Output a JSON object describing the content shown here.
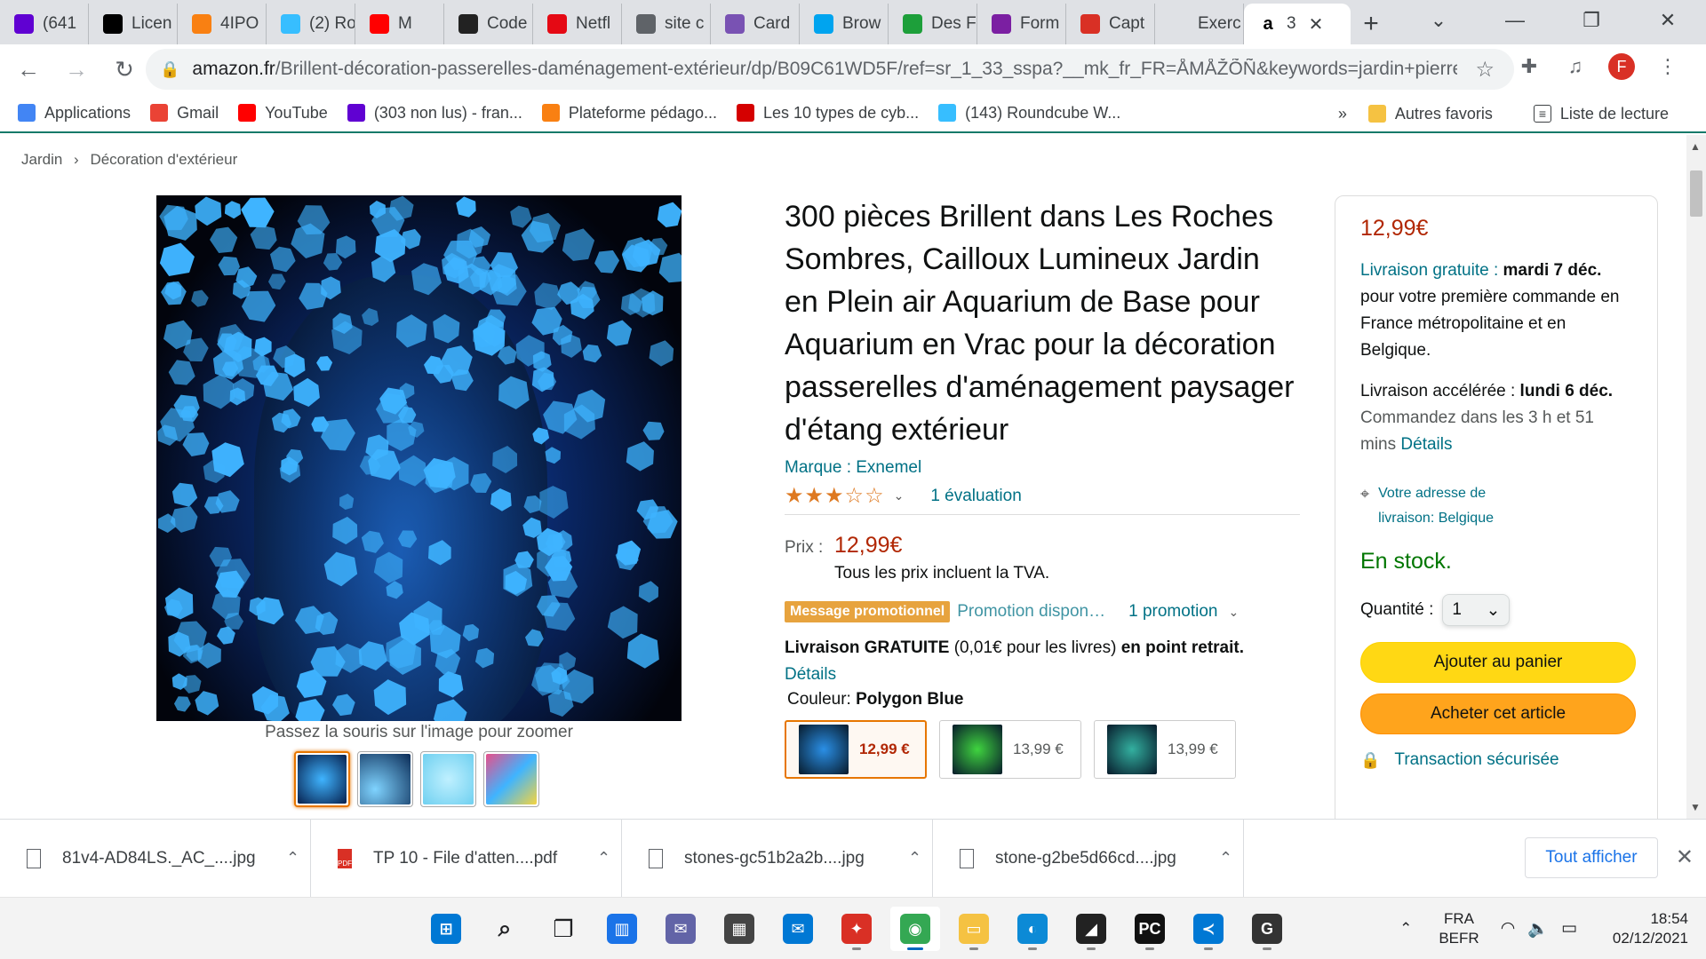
{
  "browser": {
    "tabs": [
      {
        "label": "(641",
        "icon": "mail-icon",
        "color": "#6001d2"
      },
      {
        "label": "Licen",
        "icon": "jetbrains-icon",
        "color": "#000000"
      },
      {
        "label": "4IPO",
        "icon": "moodle-icon",
        "color": "#f98012"
      },
      {
        "label": "(2) Ro",
        "icon": "roundcube-icon",
        "color": "#37beff"
      },
      {
        "label": "M",
        "icon": "youtube-icon",
        "color": "#ff0000"
      },
      {
        "label": "Code",
        "icon": "codingame-icon",
        "color": "#222222"
      },
      {
        "label": "Netfl",
        "icon": "netflix-icon",
        "color": "#e50914"
      },
      {
        "label": "site c",
        "icon": "globe-icon",
        "color": "#5f6368"
      },
      {
        "label": "Card",
        "icon": "bootstrap-icon",
        "color": "#7952b3"
      },
      {
        "label": "Brow",
        "icon": "microsoft-icon",
        "color": "#00a4ef"
      },
      {
        "label": "Des F",
        "icon": "px-icon",
        "color": "#1d9f3a"
      },
      {
        "label": "Form",
        "icon": "form-icon",
        "color": "#7b1fa2"
      },
      {
        "label": "Capt",
        "icon": "capture-icon",
        "color": "#d93025"
      },
      {
        "label": "Exerc",
        "icon": "blank-icon",
        "color": "#dfe1e5"
      }
    ],
    "active_tab": {
      "label": "3",
      "icon": "amazon-icon"
    },
    "url_host": "amazon.fr",
    "url_path": "/Brillent-décoration-passerelles-daménagement-extérieur/dp/B09C61WD5F/ref=sr_1_33_sspa?__mk_fr_FR=ÅMÅŽÕÑ&keywords=jardin+pierres...",
    "profile_initial": "F",
    "bookmarks": [
      {
        "label": "Applications",
        "icon": "apps-grid-icon"
      },
      {
        "label": "Gmail",
        "icon": "gmail-icon"
      },
      {
        "label": "YouTube",
        "icon": "youtube-icon"
      },
      {
        "label": "(303 non lus) - fran...",
        "icon": "mail-icon"
      },
      {
        "label": "Plateforme pédago...",
        "icon": "moodle-icon"
      },
      {
        "label": "Les 10 types de cyb...",
        "icon": "magnet-icon"
      },
      {
        "label": "(143) Roundcube W...",
        "icon": "roundcube-icon"
      }
    ],
    "bookmarks_more": "»",
    "other_favorites": "Autres favoris",
    "reading_list": "Liste de lecture"
  },
  "page": {
    "breadcrumb": [
      "Jardin",
      "›",
      "Décoration d'extérieur"
    ],
    "zoom_hint": "Passez la souris sur l'image pour zoomer",
    "title": "300 pièces Brillent dans Les Roches Sombres, Cailloux Lumineux Jardin en Plein air Aquarium de Base pour Aquarium en Vrac pour la décoration passerelles d'aménagement paysager d'étang extérieur",
    "brand": "Marque : Exnemel",
    "rating_stars": 3,
    "rating_count": "1 évaluation",
    "price_label": "Prix :",
    "price": "12,99€",
    "vat_note": "Tous les prix incluent la TVA.",
    "promo_badge": "Message promotionnel",
    "promo_available": "Promotion dispon…",
    "promo_count": "1 promotion",
    "free_delivery_bold": "Livraison GRATUITE",
    "free_delivery_mid": " (0,01€ pour les livres) ",
    "free_delivery_end": "en point retrait.",
    "details_link": "Détails",
    "colour_label": "Couleur: ",
    "colour_value": "Polygon Blue",
    "swatches": [
      {
        "price": "12,99 €",
        "color": "#2a8fe6"
      },
      {
        "price": "13,99 €",
        "color": "#3fd43f"
      },
      {
        "price": "13,99 €",
        "color": "#33b0a0"
      }
    ]
  },
  "buybox": {
    "price": "12,99€",
    "delivery_free": "Livraison gratuite :",
    "delivery_date": "mardi 7 déc.",
    "delivery_note": "pour votre première commande en France métropolitaine et en Belgique.",
    "fast_label": "Livraison accélérée :",
    "fast_date": "lundi 6 déc.",
    "order_within": "Commandez dans les 3 h et 51 mins",
    "order_details": "Détails",
    "address": "Votre adresse de livraison: Belgique",
    "stock": "En stock.",
    "quantity_label": "Quantité :",
    "quantity_value": "1",
    "add_to_cart": "Ajouter au panier",
    "buy_now": "Acheter cet article",
    "secure": "Transaction sécurisée"
  },
  "downloads": {
    "items": [
      {
        "name": "81v4-AD84LS._AC_....jpg",
        "type": "jpg"
      },
      {
        "name": "TP 10 - File d'atten....pdf",
        "type": "pdf"
      },
      {
        "name": "stones-gc51b2a2b....jpg",
        "type": "jpg"
      },
      {
        "name": "stone-g2be5d66cd....jpg",
        "type": "jpg"
      }
    ],
    "show_all": "Tout afficher"
  },
  "taskbar": {
    "apps": [
      {
        "name": "start-icon",
        "color": "#0078d4",
        "glyph": "⊞"
      },
      {
        "name": "search-icon",
        "color": "#f3f3f3",
        "glyph": "⌕"
      },
      {
        "name": "task-view-icon",
        "color": "#f3f3f3",
        "glyph": "❐"
      },
      {
        "name": "widgets-icon",
        "color": "#1a73e8",
        "glyph": "▥"
      },
      {
        "name": "teams-chat-icon",
        "color": "#6264a7",
        "glyph": "✉"
      },
      {
        "name": "store-icon",
        "color": "#444444",
        "glyph": "▦"
      },
      {
        "name": "mail-icon",
        "color": "#0078d4",
        "glyph": "✉"
      },
      {
        "name": "gift-icon",
        "color": "#d93025",
        "glyph": "✦"
      },
      {
        "name": "chrome-icon",
        "color": "#34a853",
        "glyph": "◉"
      },
      {
        "name": "file-explorer-icon",
        "color": "#f5c242",
        "glyph": "▭"
      },
      {
        "name": "edge-icon",
        "color": "#0c8ad6",
        "glyph": "◐"
      },
      {
        "name": "sticky-notes-icon",
        "color": "#222222",
        "glyph": "◢"
      },
      {
        "name": "pycharm-icon",
        "color": "#111111",
        "glyph": "PC"
      },
      {
        "name": "vscode-icon",
        "color": "#0078d4",
        "glyph": "≺"
      },
      {
        "name": "g-app-icon",
        "color": "#333333",
        "glyph": "G"
      }
    ],
    "active_app": 8,
    "lang_top": "FRA",
    "lang_bottom": "BEFR",
    "time": "18:54",
    "date": "02/12/2021"
  }
}
